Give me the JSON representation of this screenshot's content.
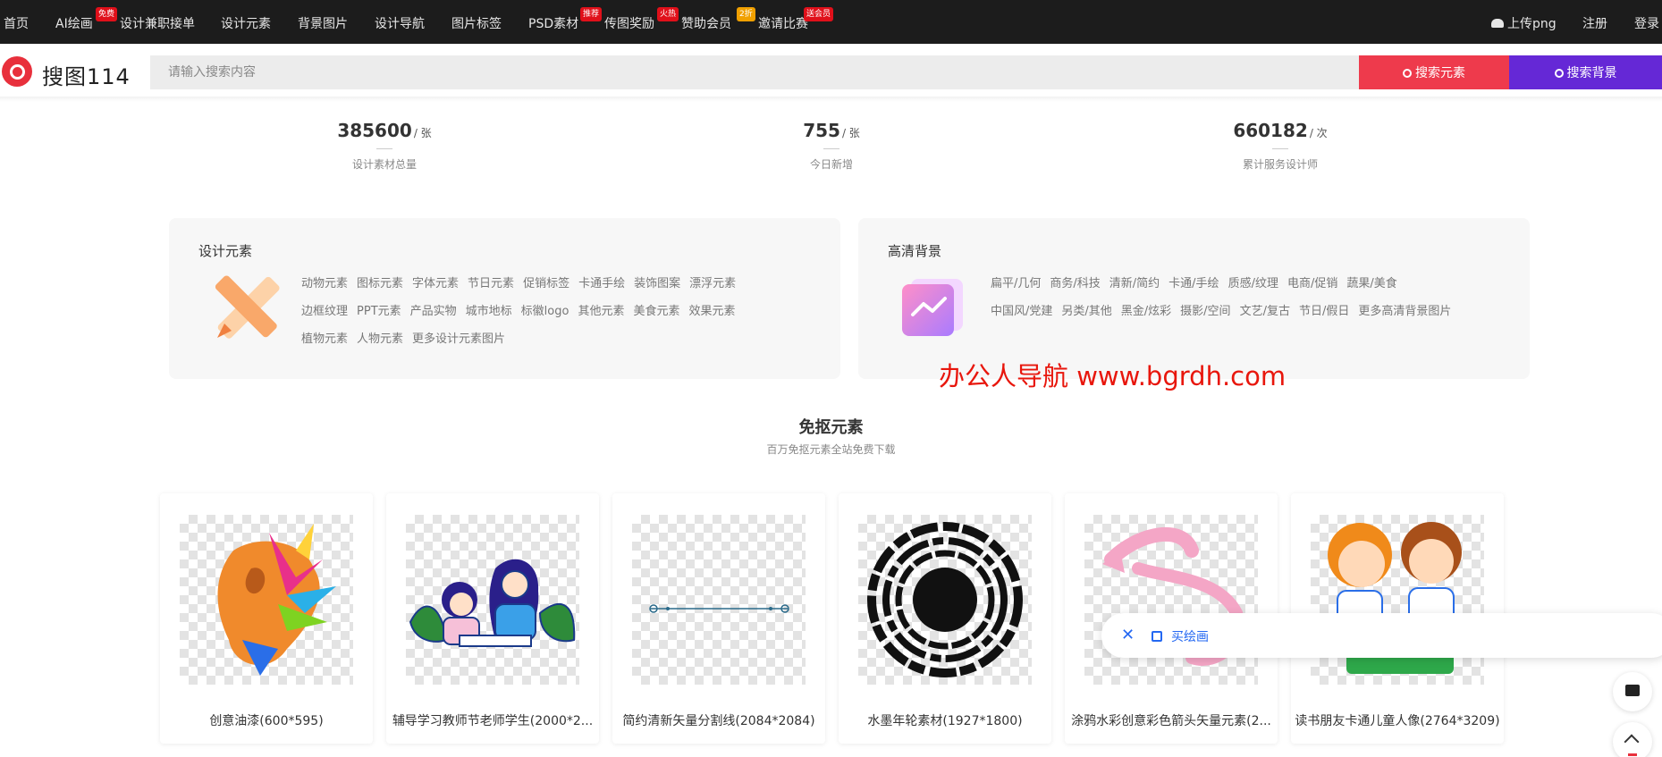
{
  "nav": {
    "items": [
      {
        "label": "首页",
        "badge": ""
      },
      {
        "label": "AI绘画",
        "badge": "免费"
      },
      {
        "label": "设计兼职接单",
        "badge": ""
      },
      {
        "label": "设计元素",
        "badge": ""
      },
      {
        "label": "背景图片",
        "badge": ""
      },
      {
        "label": "设计导航",
        "badge": ""
      },
      {
        "label": "图片标签",
        "badge": ""
      },
      {
        "label": "PSD素材",
        "badge": "推荐"
      },
      {
        "label": "传图奖励",
        "badge": "火热"
      },
      {
        "label": "赞助会员",
        "badge": "2折"
      },
      {
        "label": "邀请比赛",
        "badge": "送会员"
      }
    ],
    "upload": "上传png",
    "register": "注册",
    "login": "登录"
  },
  "search": {
    "logo_text": "搜图114",
    "placeholder": "请输入搜索内容",
    "btn_elements": "搜索元素",
    "btn_backgrounds": "搜索背景"
  },
  "stats": [
    {
      "num": "385600",
      "unit": "/ 张",
      "label": "设计素材总量"
    },
    {
      "num": "755",
      "unit": "/ 张",
      "label": "今日新增"
    },
    {
      "num": "660182",
      "unit": "/ 次",
      "label": "累计服务设计师"
    }
  ],
  "categories": {
    "elements": {
      "title": "设计元素",
      "tags": [
        "动物元素",
        "图标元素",
        "字体元素",
        "节日元素",
        "促销标签",
        "卡通手绘",
        "装饰图案",
        "漂浮元素",
        "边框纹理",
        "PPT元素",
        "产品实物",
        "城市地标",
        "标徽logo",
        "其他元素",
        "美食元素",
        "效果元素",
        "植物元素",
        "人物元素",
        "更多设计元素图片"
      ]
    },
    "backgrounds": {
      "title": "高清背景",
      "tags": [
        "扁平/几何",
        "商务/科技",
        "清新/简约",
        "卡通/手绘",
        "质感/纹理",
        "电商/促销",
        "蔬果/美食",
        "中国风/党建",
        "另类/其他",
        "黑金/炫彩",
        "摄影/空间",
        "文艺/复古",
        "节日/假日",
        "更多高清背景图片"
      ]
    }
  },
  "watermark": "办公人导航  www.bgrdh.com",
  "section": {
    "title": "免抠元素",
    "subtitle": "百万免抠元素全站免费下载"
  },
  "cards": [
    {
      "title": "创意油漆(600*595)"
    },
    {
      "title": "辅导学习教师节老师学生(2000*2..."
    },
    {
      "title": "简约清新矢量分割线(2084*2084)"
    },
    {
      "title": "水墨年轮素材(1927*1800)"
    },
    {
      "title": "涂鸦水彩创意彩色箭头矢量元素(2..."
    },
    {
      "title": "读书朋友卡通儿童人像(2764*3209)"
    }
  ],
  "float_bar": {
    "link": "买绘画"
  },
  "colors": {
    "nav_bg": "#1c1c1c",
    "btn_red": "#ee3a4c",
    "btn_purple": "#6528d6",
    "watermark": "#e8160c",
    "link_blue": "#2468f2"
  }
}
